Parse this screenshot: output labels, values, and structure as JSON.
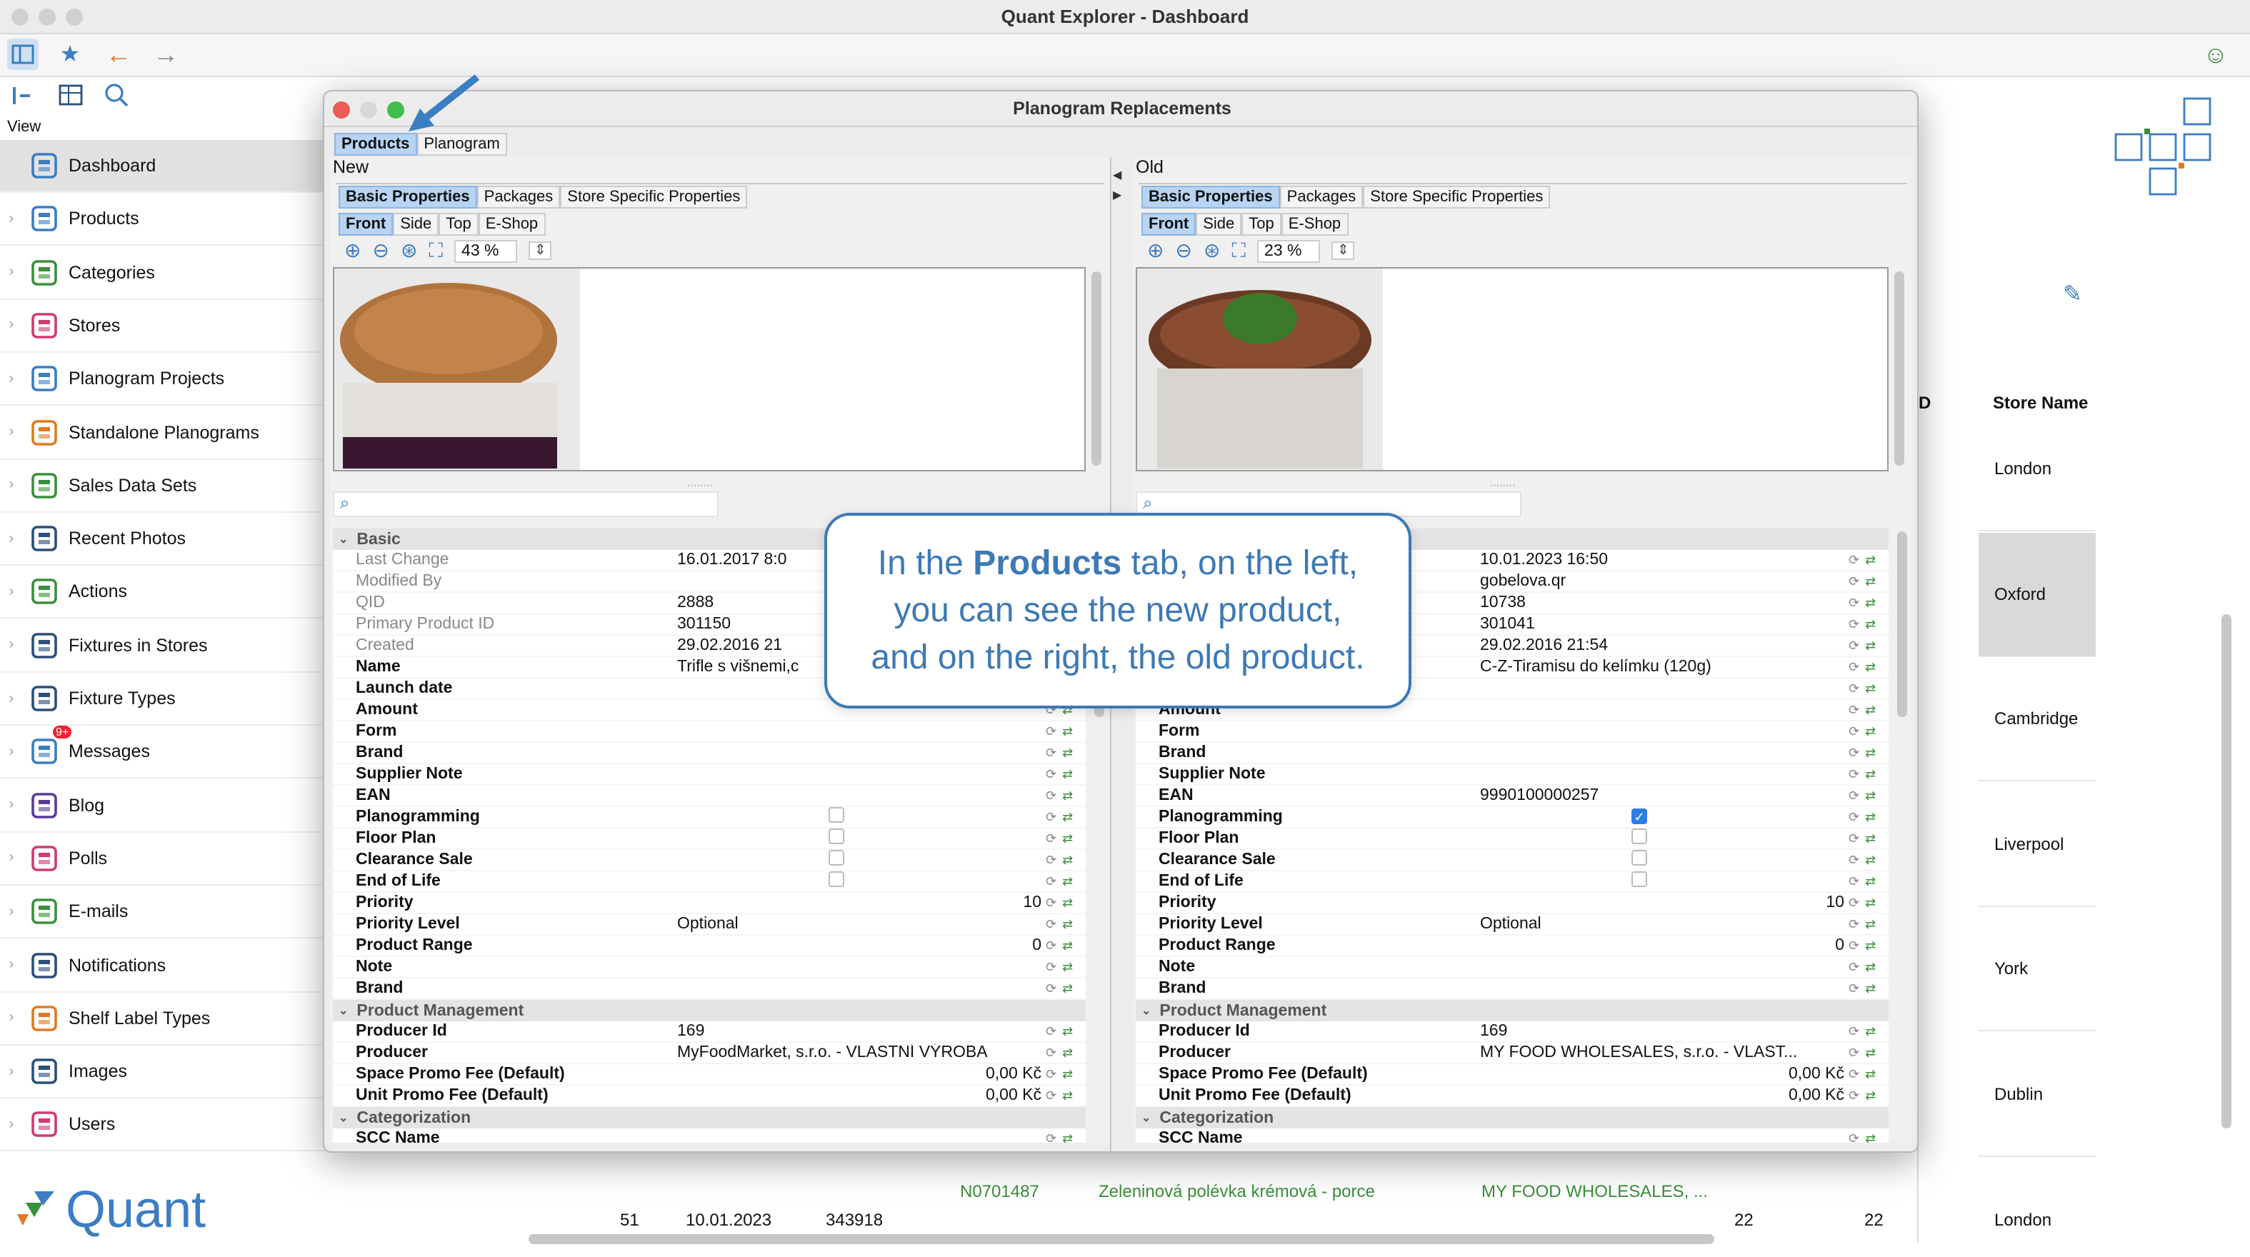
{
  "window": {
    "title": "Quant Explorer - Dashboard"
  },
  "sidebar": {
    "view_label": "View",
    "items": [
      {
        "label": "Dashboard",
        "icon": "dashboard-icon",
        "color": "#3c7dc3"
      },
      {
        "label": "Products",
        "icon": "products-icon",
        "color": "#3c7dc3"
      },
      {
        "label": "Categories",
        "icon": "categories-icon",
        "color": "#3a8f3a"
      },
      {
        "label": "Stores",
        "icon": "stores-icon",
        "color": "#d13b6a"
      },
      {
        "label": "Planogram Projects",
        "icon": "planogram-projects-icon",
        "color": "#3c7dc3"
      },
      {
        "label": "Standalone Planograms",
        "icon": "standalone-planograms-icon",
        "color": "#e07a20"
      },
      {
        "label": "Sales Data Sets",
        "icon": "sales-data-icon",
        "color": "#3a8f3a"
      },
      {
        "label": "Recent Photos",
        "icon": "camera-icon",
        "color": "#2a4f7a"
      },
      {
        "label": "Actions",
        "icon": "actions-icon",
        "color": "#3a8f3a"
      },
      {
        "label": "Fixtures in Stores",
        "icon": "fixtures-in-stores-icon",
        "color": "#2a4f7a"
      },
      {
        "label": "Fixture Types",
        "icon": "fixture-types-icon",
        "color": "#2a4f7a"
      },
      {
        "label": "Messages",
        "icon": "messages-icon",
        "color": "#3c7dc3",
        "badge": "9+"
      },
      {
        "label": "Blog",
        "icon": "blog-icon",
        "color": "#5b3a99"
      },
      {
        "label": "Polls",
        "icon": "polls-icon",
        "color": "#d13b6a"
      },
      {
        "label": "E-mails",
        "icon": "email-icon",
        "color": "#3a8f3a"
      },
      {
        "label": "Notifications",
        "icon": "notifications-icon",
        "color": "#2a4f7a"
      },
      {
        "label": "Shelf Label Types",
        "icon": "shelf-label-icon",
        "color": "#e07a20"
      },
      {
        "label": "Images",
        "icon": "images-icon",
        "color": "#2a4f7a"
      },
      {
        "label": "Users",
        "icon": "users-icon",
        "color": "#d13b6a"
      }
    ],
    "logo_text": "Quant"
  },
  "background": {
    "store_name_header": "Store Name",
    "col_d_header": "D",
    "stores": [
      "London",
      "Oxford",
      "Cambridge",
      "Liverpool",
      "York",
      "Dublin"
    ],
    "bottom_row": {
      "code": "N0701487",
      "name": "Zeleninová polévka krémová - porce",
      "supplier": "MY FOOD WHOLESALES, ...",
      "num": "51",
      "date": "10.01.2023",
      "id": "343918",
      "v1": "22",
      "v2": "22",
      "store": "London"
    }
  },
  "dialog": {
    "title": "Planogram Replacements",
    "tabs": [
      "Products",
      "Planogram"
    ],
    "new": {
      "title": "New",
      "subtabs": [
        "Basic Properties",
        "Packages",
        "Store Specific Properties"
      ],
      "views": [
        "Front",
        "Side",
        "Top",
        "E-Shop"
      ],
      "zoom": "43 %",
      "props": {
        "last_change": "16.01.2017 8:0",
        "qid": "2888",
        "primary_id": "301150",
        "created": "29.02.2016 21",
        "name": "Trifle s višnemi,c",
        "priority": "10",
        "priority_level": "Optional",
        "product_range": "0",
        "producer_id": "169",
        "producer": "MyFoodMarket, s.r.o. - VLASTNÍ VÝROBA",
        "space_fee": "0,00 Kč",
        "unit_fee": "0,00 Kč"
      }
    },
    "old": {
      "title": "Old",
      "subtabs": [
        "Basic Properties",
        "Packages",
        "Store Specific Properties"
      ],
      "views": [
        "Front",
        "Side",
        "Top",
        "E-Shop"
      ],
      "zoom": "23 %",
      "props": {
        "last_change": "10.01.2023 16:50",
        "modified_by": "gobelova.qr",
        "qid": "10738",
        "primary_id": "301041",
        "created": "29.02.2016 21:54",
        "name": "C-Z-Tiramisu do kelímku (120g)",
        "ean": "9990100000257",
        "priority": "10",
        "priority_level": "Optional",
        "product_range": "0",
        "producer_id": "169",
        "producer": "MY FOOD WHOLESALES, s.r.o. - VLAST...",
        "space_fee": "0,00 Kč",
        "unit_fee": "0,00 Kč"
      }
    },
    "labels": {
      "basic": "Basic",
      "last_change": "Last Change",
      "modified_by": "Modified By",
      "qid": "QID",
      "primary_id": "Primary Product ID",
      "created": "Created",
      "name": "Name",
      "launch_date": "Launch date",
      "amount": "Amount",
      "form": "Form",
      "brand": "Brand",
      "supplier_note": "Supplier Note",
      "ean": "EAN",
      "planogramming": "Planogramming",
      "floor_plan": "Floor Plan",
      "clearance": "Clearance Sale",
      "eol": "End of Life",
      "priority": "Priority",
      "priority_level": "Priority Level",
      "product_range": "Product Range",
      "note": "Note",
      "product_management": "Product Management",
      "producer_id": "Producer Id",
      "producer": "Producer",
      "space_fee": "Space Promo Fee (Default)",
      "unit_fee": "Unit Promo Fee (Default)",
      "categorization": "Categorization",
      "scc_name": "SCC Name"
    }
  },
  "callout": {
    "line1_pre": "In the ",
    "line1_bold": "Products",
    "line1_post": " tab, on the left,",
    "line2": "you can see the new product,",
    "line3": "and on the right, the old product."
  }
}
